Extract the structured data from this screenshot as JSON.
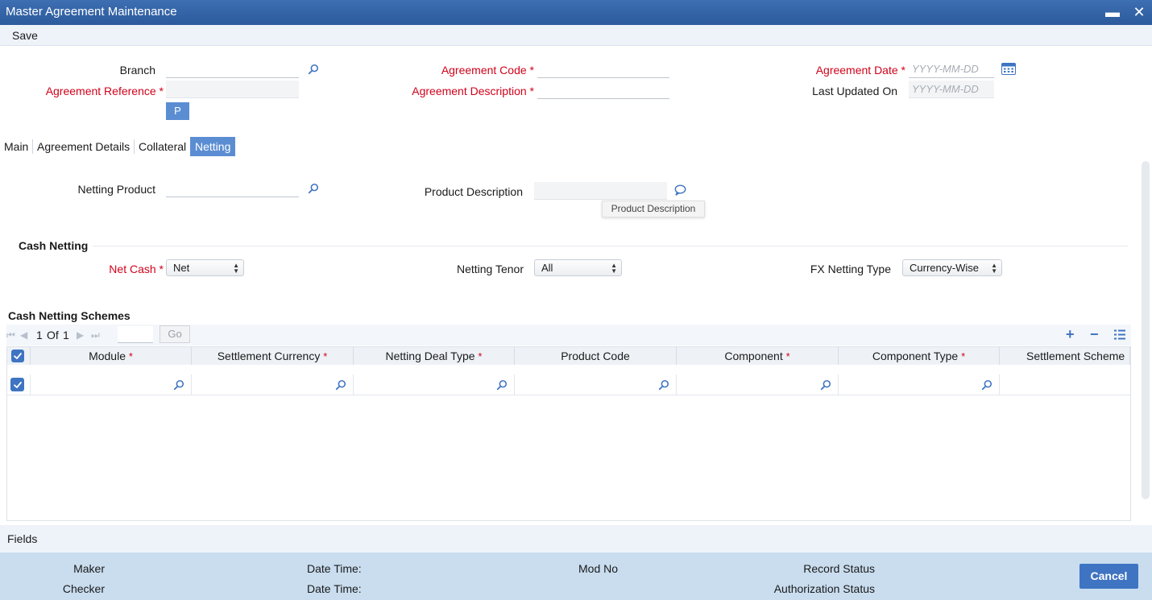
{
  "window": {
    "title": "Master Agreement Maintenance"
  },
  "toolbar": {
    "save": "Save"
  },
  "header": {
    "branch_label": "Branch",
    "agreement_reference_label": "Agreement Reference",
    "agreement_code_label": "Agreement Code",
    "agreement_description_label": "Agreement Description",
    "agreement_date_label": "Agreement Date",
    "last_updated_label": "Last Updated On",
    "date_placeholder": "YYYY-MM-DD",
    "p_button": "P",
    "required_star": "*"
  },
  "tabs": [
    {
      "label": "Main"
    },
    {
      "label": "Agreement Details"
    },
    {
      "label": "Collateral"
    },
    {
      "label": "Netting"
    }
  ],
  "netting": {
    "netting_product_label": "Netting Product",
    "product_description_label": "Product Description",
    "tooltip": "Product Description"
  },
  "cash_netting": {
    "title": "Cash Netting",
    "net_cash_label": "Net Cash",
    "net_cash_value": "Net",
    "netting_tenor_label": "Netting Tenor",
    "netting_tenor_value": "All",
    "fx_netting_type_label": "FX Netting Type",
    "fx_netting_type_value": "Currency-Wise"
  },
  "schemes": {
    "title": "Cash Netting Schemes",
    "pager": {
      "current": "1",
      "of": "Of",
      "total": "1",
      "go": "Go"
    },
    "columns": [
      {
        "label": "Module",
        "required": true
      },
      {
        "label": "Settlement Currency",
        "required": true
      },
      {
        "label": "Netting Deal Type",
        "required": true
      },
      {
        "label": "Product Code",
        "required": false
      },
      {
        "label": "Component",
        "required": true
      },
      {
        "label": "Component Type",
        "required": true
      },
      {
        "label": "Settlement Scheme",
        "required": false
      }
    ]
  },
  "fields_bar": {
    "label": "Fields"
  },
  "footer": {
    "maker": "Maker",
    "checker": "Checker",
    "date_time": "Date Time:",
    "mod_no": "Mod No",
    "record_status": "Record Status",
    "authorization_status": "Authorization Status",
    "cancel": "Cancel"
  },
  "colors": {
    "title_bar": "#2f5fa3",
    "accent": "#3f74c2",
    "required": "#d0021b",
    "footer": "#c9ddef"
  }
}
